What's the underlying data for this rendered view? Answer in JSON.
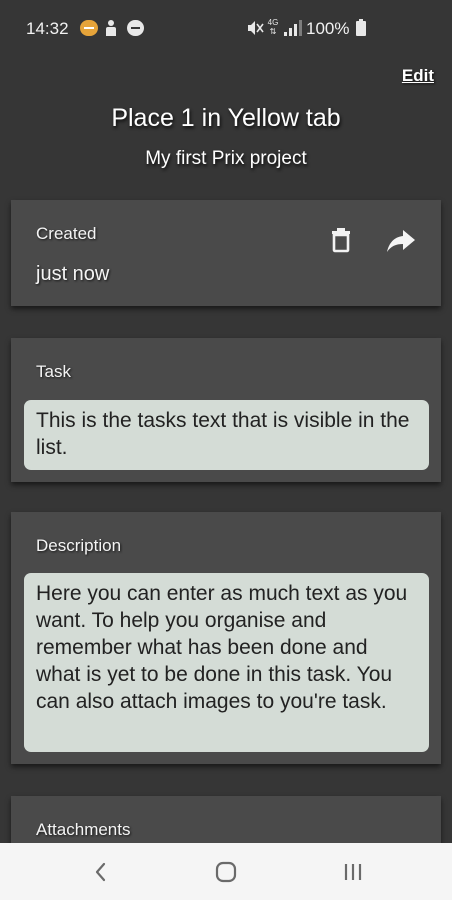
{
  "status_bar": {
    "time": "14:32",
    "battery": "100%",
    "network": "4G"
  },
  "header": {
    "edit_label": "Edit",
    "title": "Place 1 in Yellow tab",
    "subtitle": "My first Prix project"
  },
  "created": {
    "label": "Created",
    "value": "just now"
  },
  "task": {
    "label": "Task",
    "text": "This is the tasks text that is visible in the list."
  },
  "description": {
    "label": "Description",
    "text": "Here you can enter as much text as you want. To help you organise and remember what has been done and what is yet to be done in this task. You can also attach images to you're task."
  },
  "attachments": {
    "label": "Attachments"
  },
  "icons": {
    "delete": "trash-icon",
    "share": "share-icon",
    "nav_back": "chevron-left-icon",
    "nav_home": "home-icon",
    "nav_recents": "recents-icon"
  },
  "colors": {
    "background": "#363636",
    "card": "#4a4a4a",
    "text_box": "#d4dcd6",
    "nav_bar": "#f5f5f5"
  }
}
